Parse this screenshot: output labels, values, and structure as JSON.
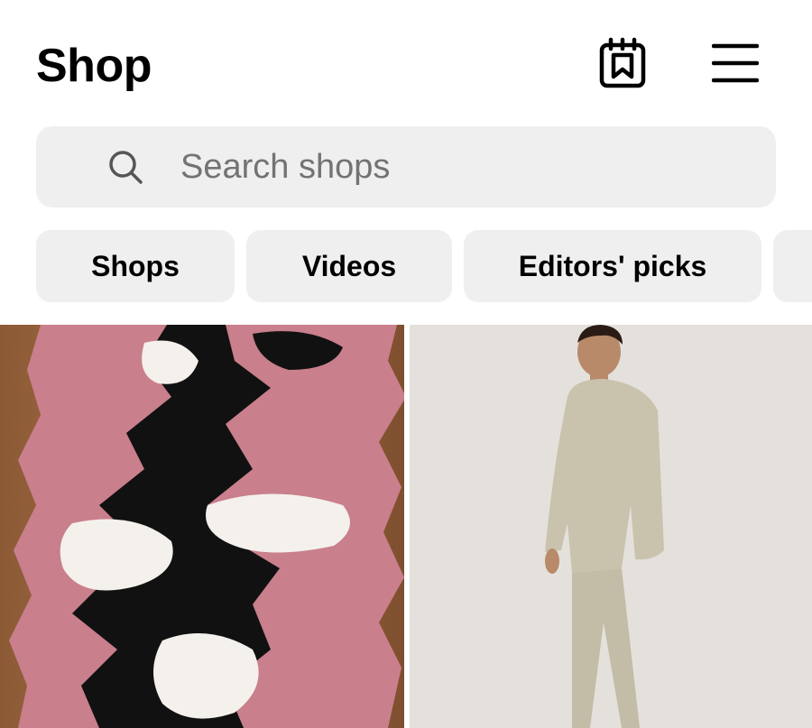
{
  "header": {
    "title": "Shop",
    "saved_icon": "bookmark-calendar-icon",
    "menu_icon": "hamburger-menu-icon"
  },
  "search": {
    "icon": "search-icon",
    "placeholder": "Search shops",
    "value": ""
  },
  "chips": [
    {
      "label": "Shops"
    },
    {
      "label": "Videos"
    },
    {
      "label": "Editors' picks"
    }
  ],
  "grid": [
    {
      "description_icon": "image-rug"
    },
    {
      "description_icon": "image-model-tracksuit"
    }
  ],
  "colors": {
    "background": "#ffffff",
    "chip_bg": "#efefef",
    "text": "#000000",
    "placeholder": "#737373"
  }
}
